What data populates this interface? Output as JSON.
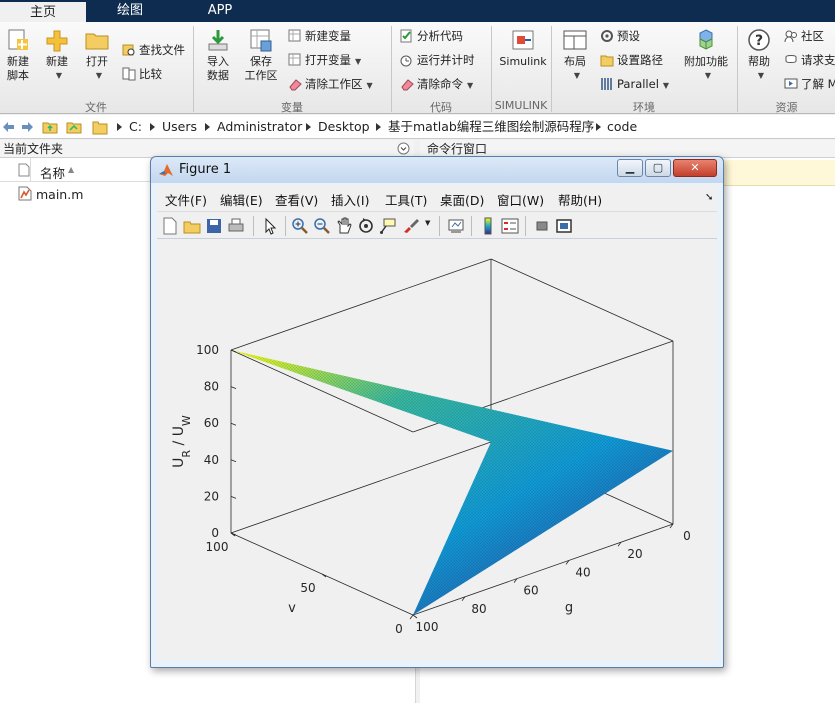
{
  "tabs": [
    {
      "label": "主页",
      "active": true
    },
    {
      "label": "绘图",
      "active": false
    },
    {
      "label": "APP",
      "active": false
    }
  ],
  "ribbon": {
    "file_section": {
      "label": "文件",
      "new_script": "新建\n脚本",
      "new": "新建",
      "open": "打开",
      "find_files": "查找文件",
      "compare": "比较"
    },
    "variable_section": {
      "label": "变量",
      "import_data": "导入\n数据",
      "save_workspace": "保存\n工作区",
      "new_variable": "新建变量",
      "open_variable": "打开变量",
      "clear_workspace": "清除工作区"
    },
    "code_section": {
      "label": "代码",
      "analyze_code": "分析代码",
      "run_and_time": "运行并计时",
      "clear_commands": "清除命令"
    },
    "simulink_section": {
      "label": "SIMULINK",
      "simulink": "Simulink"
    },
    "environment_section": {
      "label": "环境",
      "layout": "布局",
      "preferences": "预设",
      "set_path": "设置路径",
      "parallel": "Parallel",
      "addons": "附加功能"
    },
    "resources_section": {
      "label": "资源",
      "help": "帮助",
      "community": "社区",
      "request_support": "请求支",
      "learn": "了解 M"
    }
  },
  "path": {
    "segments": [
      "C:",
      "Users",
      "Administrator",
      "Desktop",
      "基于matlab编程三维图绘制源码程序",
      "code"
    ]
  },
  "current_folder": {
    "title": "当前文件夹",
    "name_column": "名称",
    "sort_indicator": "▲",
    "files": [
      {
        "name": "main.m"
      }
    ]
  },
  "command_window": {
    "title": "命令行窗口"
  },
  "figure": {
    "title": "Figure 1",
    "menu": [
      "文件(F)",
      "编辑(E)",
      "查看(V)",
      "插入(I)",
      "工具(T)",
      "桌面(D)",
      "窗口(W)",
      "帮助(H)"
    ],
    "toolbar_icons": [
      "new-figure-icon",
      "open-icon",
      "save-icon",
      "print-icon",
      "pointer-icon",
      "zoom-in-icon",
      "zoom-out-icon",
      "pan-icon",
      "rotate-3d-icon",
      "data-cursor-icon",
      "brush-icon",
      "link-plot-icon",
      "colorbar-icon",
      "legend-icon",
      "hide-plot-tools-icon",
      "show-plot-tools-icon"
    ]
  },
  "chart_data": {
    "type": "surface",
    "title": "",
    "zlabel": "U_R / U_W",
    "xlabel": "g",
    "ylabel": "v",
    "xlim": [
      0,
      100
    ],
    "ylim": [
      0,
      100
    ],
    "zlim": [
      0,
      100
    ],
    "x_ticks": [
      "0",
      "20",
      "40",
      "60",
      "80",
      "100"
    ],
    "y_ticks": [
      "0",
      "50",
      "100"
    ],
    "z_ticks": [
      "0",
      "20",
      "40",
      "60",
      "80",
      "100"
    ],
    "colormap": "parula",
    "colors": {
      "low": "#352a87",
      "mid": "#0f9bd6",
      "mid2": "#38b99e",
      "high": "#f9fb0e"
    },
    "surface_points": [
      {
        "g": 100,
        "v": 0,
        "value": 0
      },
      {
        "g": 0,
        "v": 0,
        "value": 40
      },
      {
        "g": 100,
        "v": 100,
        "value": 100
      },
      {
        "g": 0,
        "v": 100,
        "value": 0
      }
    ]
  }
}
